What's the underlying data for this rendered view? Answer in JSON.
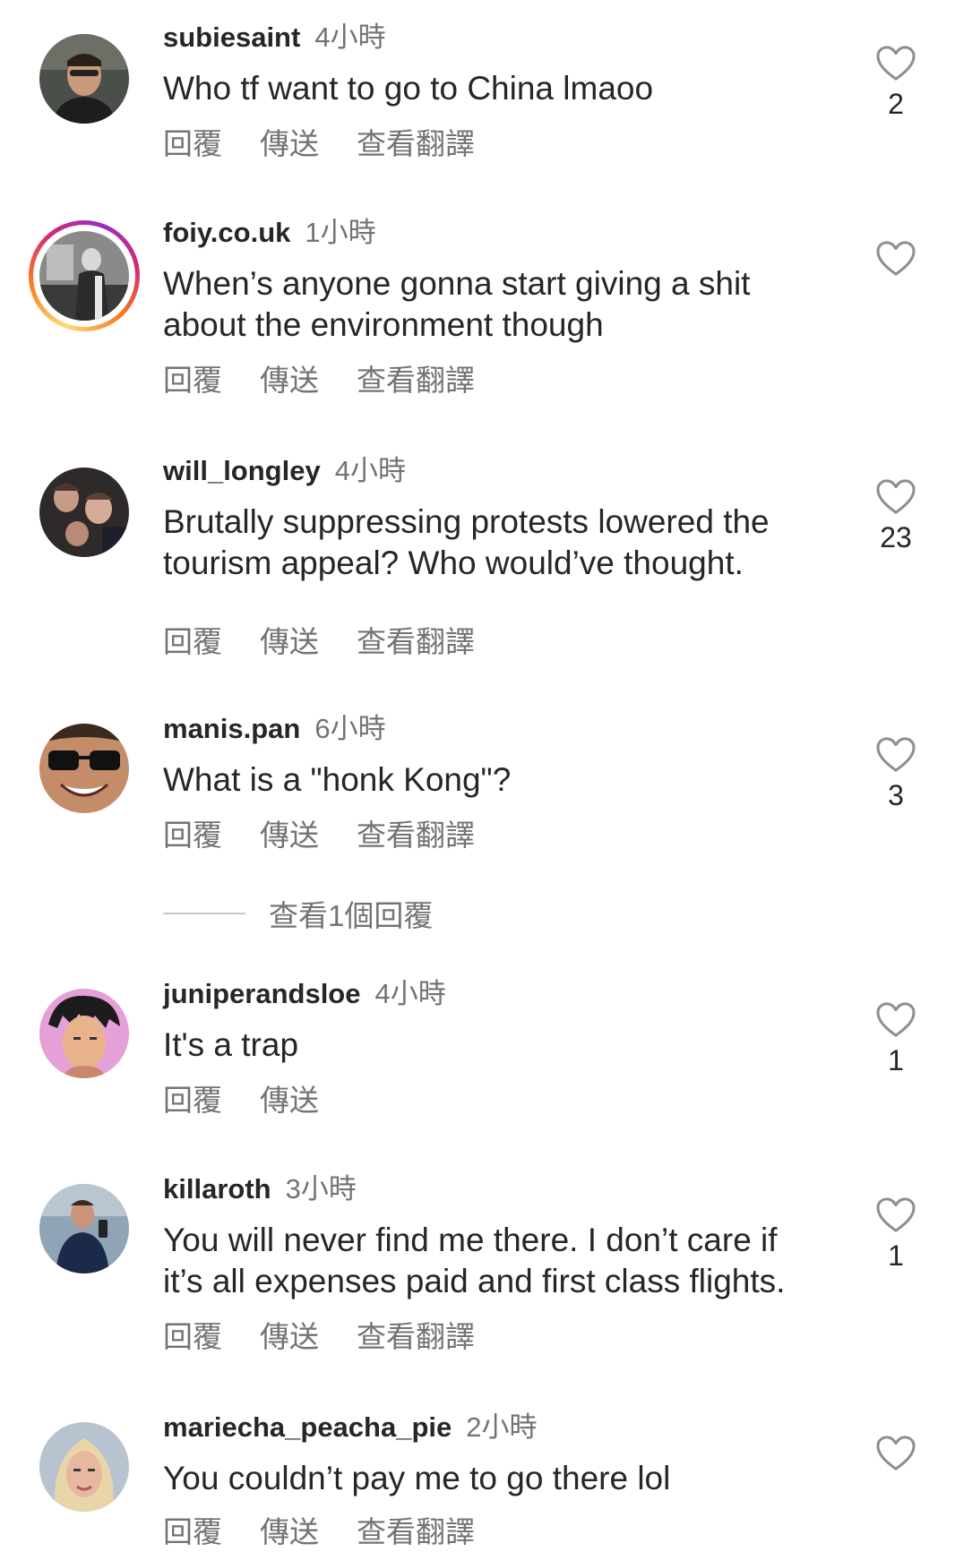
{
  "colors": {
    "text_primary": "#262626",
    "text_secondary": "#737373",
    "divider": "#c7c7c7",
    "story_ring": [
      "#feda75",
      "#fa7e1e",
      "#d62976",
      "#962fbf"
    ]
  },
  "comments": [
    {
      "username": "subiesaint",
      "time": "4小時",
      "text": "Who tf want to go to China lmaoo",
      "actions": {
        "reply": "回覆",
        "send": "傳送",
        "translate": "查看翻譯"
      },
      "likes": "2",
      "icon": "heart-outline-icon"
    },
    {
      "username": "foiy.co.uk",
      "time": "1小時",
      "text": "When’s anyone gonna start giving a shit about the environment though",
      "actions": {
        "reply": "回覆",
        "send": "傳送",
        "translate": "查看翻譯"
      },
      "likes": "",
      "icon": "heart-outline-icon"
    },
    {
      "username": "will_longley",
      "time": "4小時",
      "text": "Brutally suppressing protests lowered the tourism appeal? Who would’ve thought.",
      "actions": {
        "reply": "回覆",
        "send": "傳送",
        "translate": "查看翻譯"
      },
      "likes": "23",
      "icon": "heart-outline-icon"
    },
    {
      "username": "manis.pan",
      "time": "6小時",
      "text": "What is a \"honk Kong\"?",
      "actions": {
        "reply": "回覆",
        "send": "傳送",
        "translate": "查看翻譯"
      },
      "likes": "3",
      "icon": "heart-outline-icon"
    },
    {
      "username": "juniperandsloe",
      "time": "4小時",
      "text": "It's a trap",
      "actions": {
        "reply": "回覆",
        "send": "傳送"
      },
      "likes": "1",
      "icon": "heart-outline-icon"
    },
    {
      "username": "killaroth",
      "time": "3小時",
      "text": "You will never find me there. I don’t care if it’s all expenses paid and first class flights.",
      "actions": {
        "reply": "回覆",
        "send": "傳送",
        "translate": "查看翻譯"
      },
      "likes": "1",
      "icon": "heart-outline-icon"
    },
    {
      "username": "mariecha_peacha_pie",
      "time": "2小時",
      "text": "You couldn’t pay me to go there lol",
      "actions": {
        "reply": "回覆",
        "send": "傳送",
        "translate": "查看翻譯"
      },
      "likes": "",
      "icon": "heart-outline-icon"
    }
  ],
  "view_replies": {
    "label": "查看1個回覆"
  }
}
